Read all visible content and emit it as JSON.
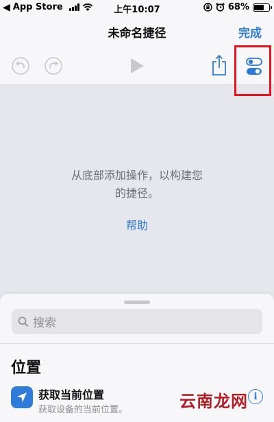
{
  "status_bar": {
    "back_label": "App Store",
    "time": "上午10:07",
    "battery": "68%",
    "battery_level": 0.68
  },
  "nav": {
    "title": "未命名捷径",
    "done_label": "完成"
  },
  "toolbar": {
    "icons": [
      "undo-icon",
      "redo-icon",
      "play-icon",
      "share-icon",
      "settings-toggle-icon"
    ],
    "highlight_color": "#e8141c"
  },
  "empty_state": {
    "line1": "从底部添加操作，以构建您",
    "line2": "的捷径。",
    "help_label": "帮助"
  },
  "sheet": {
    "search_placeholder": "搜索",
    "section_title": "位置",
    "action": {
      "title": "获取当前位置",
      "subtitle": "获取设备的当前位置。",
      "icon": "location-arrow-icon",
      "info": "i"
    }
  },
  "watermark": "云南龙网",
  "colors": {
    "accent": "#2f7cd8",
    "background": "#e6e7ec",
    "bar": "#f7f7f9"
  }
}
